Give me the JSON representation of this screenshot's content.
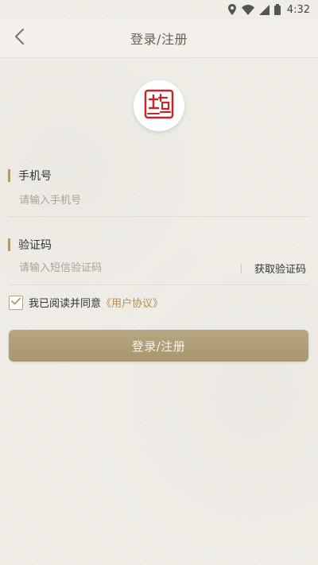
{
  "status_bar": {
    "time": "4:32",
    "icons": [
      "location-icon",
      "wifi-icon",
      "signal-icon",
      "battery-icon"
    ]
  },
  "header": {
    "title": "登录/注册",
    "back_icon": "chevron-left-icon"
  },
  "logo": {
    "icon": "seal-logo-icon",
    "brand_color": "#c0282b"
  },
  "phone": {
    "label": "手机号",
    "placeholder": "请输入手机号",
    "value": ""
  },
  "code": {
    "label": "验证码",
    "placeholder": "请输入短信验证码",
    "value": "",
    "get_code_label": "获取验证码"
  },
  "agreement": {
    "checked": true,
    "text": "我已阅读并同意",
    "link": "《用户协议》"
  },
  "login_button": {
    "label": "登录/注册"
  },
  "colors": {
    "accent": "#b49a6a",
    "button": "#ad9b74",
    "link": "#b48e52",
    "background": "#f1eee8"
  }
}
